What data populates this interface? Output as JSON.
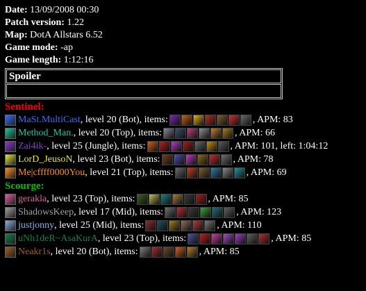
{
  "meta": {
    "date_label": "Date:",
    "date_value": " 13/09/2008 00:30",
    "patch_label": "Patch version:",
    "patch_value": " 1.22",
    "map_label": "Map:",
    "map_value": " DotA Allstars 6.52",
    "mode_label": "Game mode:",
    "mode_value": " -ap",
    "length_label": "Game length:",
    "length_value": " 1:12:16"
  },
  "spoiler": {
    "title": "Spoiler"
  },
  "teams": [
    {
      "name": "Sentinel:",
      "color": "#ff0000",
      "players": [
        {
          "name": "MaSt.MultiCast",
          "color": "#3a6cff",
          "text": ", level 20 (Bot), items:",
          "tail": ", APM: 83",
          "items": [
            "#7a2ab0",
            "#c86418",
            "#e0b020",
            "#b83020",
            "#806030",
            "#d03030",
            "#6a6a6a"
          ]
        },
        {
          "name": "Method_Man.",
          "color": "#1ec8a0",
          "text": ", level 20 (Top), items:",
          "tail": ", APM: 66",
          "items": [
            "#8a8a9a",
            "#405070",
            "#c04080",
            "#909090",
            "#c08030",
            "#a08020"
          ]
        },
        {
          "name": "Zai4ik-",
          "color": "#8a3ad0",
          "text": ", level 25 (Jungle), items:",
          "tail": ", APM: 101, left: 1:04:12",
          "items": [
            "#d06020",
            "#b02020",
            "#b040c0",
            "#a02020",
            "#6a6a6a",
            "#c09020",
            "#5a5a5a"
          ]
        },
        {
          "name": "LorD_JeusoN",
          "color": "#e8e840",
          "text": ", level 23 (Bot), items:",
          "tail": ", APM: 78",
          "items": [
            "#704020",
            "#5050b0",
            "#c040c0",
            "#8a6a20",
            "#c03030",
            "#707070"
          ]
        },
        {
          "name": "Me|cffff0000You",
          "color": "#ff9020",
          "text": ", level 21 (Top), items:",
          "tail": ", APM: 69",
          "items": [
            "#6a6a6a",
            "#c04020",
            "#806030",
            "#3080a0",
            "#8a8a8a",
            "#2a90a0"
          ]
        }
      ]
    },
    {
      "name": "Scourge:",
      "color": "#00c000",
      "players": [
        {
          "name": "gerakla",
          "color": "#e060a0",
          "text": ", level 23 (Top), items:",
          "tail": ", APM: 85",
          "items": [
            "#406020",
            "#c0c060",
            "#208080",
            "#a08040",
            "#3a3a3a",
            "#a02020"
          ]
        },
        {
          "name": "ShadowsKeep",
          "color": "#a0a0a0",
          "text": ", level 17 (Mid), items:",
          "tail": ", APM: 123",
          "items": [
            "#707070",
            "#b03030",
            "#3a3a3a",
            "#40a040",
            "#207080",
            "#606060"
          ]
        },
        {
          "name": "justjonny",
          "color": "#8ab0e8",
          "text": ", level 25 (Mid), items:",
          "tail": ", APM: 110",
          "items": [
            "#8a3030",
            "#205060",
            "#a08020",
            "#907060",
            "#b04040",
            "#7a7a7a"
          ]
        },
        {
          "name": "uNh1deR~AsaKurA",
          "color": "#108050",
          "text": ", level 23 (Top), items:",
          "tail": ", APM: 85",
          "items": [
            "#5050a0",
            "#c02020",
            "#d040a0",
            "#a050c0",
            "#a040c0",
            "#606060",
            "#b03030"
          ]
        },
        {
          "name": "Neakr1s",
          "color": "#a06020",
          "text": ", level 20 (Bot), items:",
          "tail": ", APM: 85",
          "items": [
            "#808080",
            "#a03030",
            "#6a4a2a",
            "#d06020",
            "#b08030"
          ]
        }
      ]
    }
  ]
}
